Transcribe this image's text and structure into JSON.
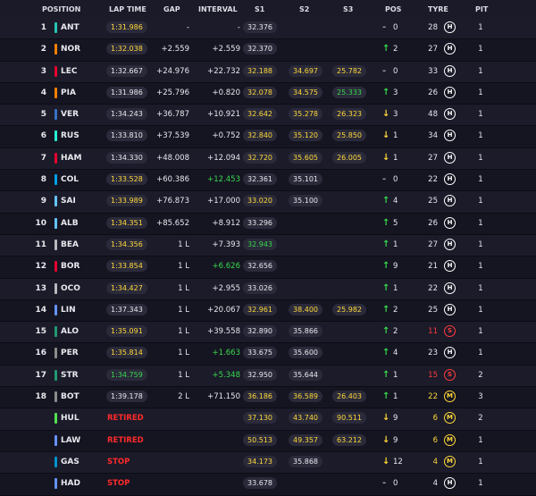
{
  "header": {
    "position": "POSITION",
    "lap_time": "LAP TIME",
    "gap": "GAP",
    "interval": "INTERVAL",
    "s1": "S1",
    "s2": "S2",
    "s3": "S3",
    "pos": "POS",
    "tyre": "TYRE",
    "pit": "PIT"
  },
  "rows": [
    {
      "pos": "1",
      "code": "ANT",
      "team": "#26c6b3",
      "lap": "1:31.986",
      "lap_c": "yellow",
      "gap": "-",
      "interval": "-",
      "s1": "32.376",
      "s1_c": "white",
      "s2": "",
      "s2_c": "white",
      "s3": "",
      "s3_c": "white",
      "arrow": "-",
      "arrow_c": "gray",
      "posch": "0",
      "laps": "28",
      "tyre": "H",
      "tyre_c": "#ffffff",
      "laps_c": "white",
      "pit": "1"
    },
    {
      "pos": "2",
      "code": "NOR",
      "team": "#ff8000",
      "lap": "1:32.038",
      "lap_c": "yellow",
      "gap": "+2.559",
      "interval": "+2.559",
      "s1": "32.370",
      "s1_c": "white",
      "s2": "",
      "s2_c": "white",
      "s3": "",
      "s3_c": "white",
      "arrow": "↑",
      "arrow_c": "green",
      "posch": "2",
      "laps": "27",
      "tyre": "H",
      "tyre_c": "#ffffff",
      "laps_c": "white",
      "pit": "1"
    },
    {
      "pos": "3",
      "code": "LEC",
      "team": "#e8002d",
      "lap": "1:32.667",
      "lap_c": "white",
      "gap": "+24.976",
      "interval": "+22.732",
      "s1": "32.188",
      "s1_c": "yellow",
      "s2": "34.697",
      "s2_c": "yellow",
      "s3": "25.782",
      "s3_c": "yellow",
      "arrow": "-",
      "arrow_c": "gray",
      "posch": "0",
      "laps": "33",
      "tyre": "H",
      "tyre_c": "#ffffff",
      "laps_c": "white",
      "pit": "1"
    },
    {
      "pos": "4",
      "code": "PIA",
      "team": "#ff8000",
      "lap": "1:31.986",
      "lap_c": "white",
      "gap": "+25.796",
      "interval": "+0.820",
      "s1": "32.078",
      "s1_c": "yellow",
      "s2": "34.575",
      "s2_c": "yellow",
      "s3": "25.333",
      "s3_c": "green",
      "arrow": "↑",
      "arrow_c": "green",
      "posch": "3",
      "laps": "26",
      "tyre": "H",
      "tyre_c": "#ffffff",
      "laps_c": "white",
      "pit": "1"
    },
    {
      "pos": "5",
      "code": "VER",
      "team": "#3671c6",
      "lap": "1:34.243",
      "lap_c": "white",
      "gap": "+36.787",
      "interval": "+10.921",
      "s1": "32.642",
      "s1_c": "yellow",
      "s2": "35.278",
      "s2_c": "yellow",
      "s3": "26.323",
      "s3_c": "yellow",
      "arrow": "↓",
      "arrow_c": "yellow",
      "posch": "3",
      "laps": "48",
      "tyre": "H",
      "tyre_c": "#ffffff",
      "laps_c": "white",
      "pit": "1"
    },
    {
      "pos": "6",
      "code": "RUS",
      "team": "#27f4d2",
      "lap": "1:33.810",
      "lap_c": "white",
      "gap": "+37.539",
      "interval": "+0.752",
      "s1": "32.840",
      "s1_c": "yellow",
      "s2": "35.120",
      "s2_c": "yellow",
      "s3": "25.850",
      "s3_c": "yellow",
      "arrow": "↓",
      "arrow_c": "yellow",
      "posch": "1",
      "laps": "34",
      "tyre": "H",
      "tyre_c": "#ffffff",
      "laps_c": "white",
      "pit": "1"
    },
    {
      "pos": "7",
      "code": "HAM",
      "team": "#e8002d",
      "lap": "1:34.330",
      "lap_c": "white",
      "gap": "+48.008",
      "interval": "+12.094",
      "s1": "32.720",
      "s1_c": "yellow",
      "s2": "35.605",
      "s2_c": "yellow",
      "s3": "26.005",
      "s3_c": "yellow",
      "arrow": "↓",
      "arrow_c": "yellow",
      "posch": "1",
      "laps": "27",
      "tyre": "H",
      "tyre_c": "#ffffff",
      "laps_c": "white",
      "pit": "1"
    },
    {
      "pos": "8",
      "code": "COL",
      "team": "#00a1e8",
      "lap": "1:33.528",
      "lap_c": "yellow",
      "gap": "+60.386",
      "interval": "+12.453",
      "int_c": "green",
      "s1": "32.361",
      "s1_c": "white",
      "s2": "35.101",
      "s2_c": "white",
      "s3": "",
      "s3_c": "white",
      "arrow": "-",
      "arrow_c": "gray",
      "posch": "0",
      "laps": "22",
      "tyre": "H",
      "tyre_c": "#ffffff",
      "laps_c": "white",
      "pit": "1"
    },
    {
      "pos": "9",
      "code": "SAI",
      "team": "#64c4ff",
      "lap": "1:33.989",
      "lap_c": "yellow",
      "gap": "+76.873",
      "interval": "+17.000",
      "s1": "33.020",
      "s1_c": "yellow",
      "s2": "35.100",
      "s2_c": "white",
      "s3": "",
      "s3_c": "white",
      "arrow": "↑",
      "arrow_c": "green",
      "posch": "4",
      "laps": "25",
      "tyre": "H",
      "tyre_c": "#ffffff",
      "laps_c": "white",
      "pit": "1"
    },
    {
      "pos": "10",
      "code": "ALB",
      "team": "#64c4ff",
      "lap": "1:34.351",
      "lap_c": "yellow",
      "gap": "+85.652",
      "interval": "+8.912",
      "s1": "33.296",
      "s1_c": "white",
      "s2": "",
      "s2_c": "white",
      "s3": "",
      "s3_c": "white",
      "arrow": "↑",
      "arrow_c": "green",
      "posch": "5",
      "laps": "26",
      "tyre": "H",
      "tyre_c": "#ffffff",
      "laps_c": "white",
      "pit": "1"
    },
    {
      "pos": "11",
      "code": "BEA",
      "team": "#b6babd",
      "lap": "1:34.356",
      "lap_c": "yellow",
      "gap": "1 L",
      "interval": "+7.393",
      "s1": "32.943",
      "s1_c": "green",
      "s2": "",
      "s2_c": "white",
      "s3": "",
      "s3_c": "white",
      "arrow": "↑",
      "arrow_c": "green",
      "posch": "1",
      "laps": "27",
      "tyre": "H",
      "tyre_c": "#ffffff",
      "laps_c": "white",
      "pit": "1"
    },
    {
      "pos": "12",
      "code": "BOR",
      "team": "#e8002d",
      "lap": "1:33.854",
      "lap_c": "yellow",
      "gap": "1 L",
      "interval": "+6.626",
      "int_c": "green",
      "s1": "32.656",
      "s1_c": "white",
      "s2": "",
      "s2_c": "white",
      "s3": "",
      "s3_c": "white",
      "arrow": "↑",
      "arrow_c": "green",
      "posch": "9",
      "laps": "21",
      "tyre": "H",
      "tyre_c": "#ffffff",
      "laps_c": "white",
      "pit": "1"
    },
    {
      "pos": "13",
      "code": "OCO",
      "team": "#b6babd",
      "lap": "1:34.427",
      "lap_c": "yellow",
      "gap": "1 L",
      "interval": "+2.955",
      "s1": "33.026",
      "s1_c": "white",
      "s2": "",
      "s2_c": "white",
      "s3": "",
      "s3_c": "white",
      "arrow": "↑",
      "arrow_c": "green",
      "posch": "1",
      "laps": "22",
      "tyre": "H",
      "tyre_c": "#ffffff",
      "laps_c": "white",
      "pit": "1"
    },
    {
      "pos": "14",
      "code": "LIN",
      "team": "#6692ff",
      "lap": "1:37.343",
      "lap_c": "white",
      "gap": "1 L",
      "interval": "+20.067",
      "s1": "32.961",
      "s1_c": "yellow",
      "s2": "38.400",
      "s2_c": "yellow",
      "s3": "25.982",
      "s3_c": "yellow",
      "arrow": "↑",
      "arrow_c": "green",
      "posch": "2",
      "laps": "25",
      "tyre": "H",
      "tyre_c": "#ffffff",
      "laps_c": "white",
      "pit": "1"
    },
    {
      "pos": "15",
      "code": "ALO",
      "team": "#229971",
      "lap": "1:35.091",
      "lap_c": "yellow",
      "gap": "1 L",
      "interval": "+39.558",
      "s1": "32.890",
      "s1_c": "white",
      "s2": "35.866",
      "s2_c": "white",
      "s3": "",
      "s3_c": "white",
      "arrow": "↑",
      "arrow_c": "green",
      "posch": "2",
      "laps": "11",
      "tyre": "S",
      "tyre_c": "#ff3b3b",
      "laps_c": "red",
      "pit": "1"
    },
    {
      "pos": "16",
      "code": "PER",
      "team": "#8b8b8b",
      "lap": "1:35.814",
      "lap_c": "yellow",
      "gap": "1 L",
      "interval": "+1.663",
      "int_c": "green",
      "s1": "33.675",
      "s1_c": "white",
      "s2": "35.600",
      "s2_c": "white",
      "s3": "",
      "s3_c": "white",
      "arrow": "↑",
      "arrow_c": "green",
      "posch": "4",
      "laps": "23",
      "tyre": "H",
      "tyre_c": "#ffffff",
      "laps_c": "white",
      "pit": "1"
    },
    {
      "pos": "17",
      "code": "STR",
      "team": "#229971",
      "lap": "1:34.759",
      "lap_c": "green",
      "gap": "1 L",
      "interval": "+5.348",
      "int_c": "green",
      "s1": "32.950",
      "s1_c": "white",
      "s2": "35.644",
      "s2_c": "white",
      "s3": "",
      "s3_c": "white",
      "arrow": "↑",
      "arrow_c": "green",
      "posch": "1",
      "laps": "15",
      "tyre": "S",
      "tyre_c": "#ff3b3b",
      "laps_c": "red",
      "pit": "2"
    },
    {
      "pos": "18",
      "code": "BOT",
      "team": "#8b8b8b",
      "lap": "1:39.178",
      "lap_c": "white",
      "gap": "2 L",
      "interval": "+71.150",
      "s1": "36.186",
      "s1_c": "yellow",
      "s2": "36.589",
      "s2_c": "yellow",
      "s3": "26.403",
      "s3_c": "yellow",
      "arrow": "↑",
      "arrow_c": "green",
      "posch": "1",
      "laps": "22",
      "tyre": "M",
      "tyre_c": "#ffd83a",
      "laps_c": "yellow",
      "pit": "3"
    },
    {
      "pos": "",
      "code": "HUL",
      "team": "#52e252",
      "status": "RETIRED",
      "lap": "",
      "lap_c": "white",
      "gap": "",
      "interval": "",
      "s1": "37.130",
      "s1_c": "yellow",
      "s2": "43.740",
      "s2_c": "yellow",
      "s3": "90.511",
      "s3_c": "yellow",
      "arrow": "↓",
      "arrow_c": "yellow",
      "posch": "9",
      "laps": "6",
      "tyre": "M",
      "tyre_c": "#ffd83a",
      "laps_c": "yellow",
      "pit": "2"
    },
    {
      "pos": "",
      "code": "LAW",
      "team": "#6692ff",
      "status": "RETIRED",
      "lap": "",
      "lap_c": "white",
      "gap": "",
      "interval": "",
      "s1": "50.513",
      "s1_c": "yellow",
      "s2": "49.357",
      "s2_c": "yellow",
      "s3": "63.212",
      "s3_c": "yellow",
      "arrow": "↓",
      "arrow_c": "yellow",
      "posch": "9",
      "laps": "6",
      "tyre": "M",
      "tyre_c": "#ffd83a",
      "laps_c": "yellow",
      "pit": "1"
    },
    {
      "pos": "",
      "code": "GAS",
      "team": "#0093cc",
      "status": "STOP",
      "lap": "",
      "lap_c": "white",
      "gap": "",
      "interval": "",
      "s1": "34.173",
      "s1_c": "yellow",
      "s2": "35.868",
      "s2_c": "white",
      "s3": "",
      "s3_c": "white",
      "arrow": "↓",
      "arrow_c": "yellow",
      "posch": "12",
      "laps": "4",
      "tyre": "M",
      "tyre_c": "#ffd83a",
      "laps_c": "yellow",
      "pit": "1"
    },
    {
      "pos": "",
      "code": "HAD",
      "team": "#6692ff",
      "status": "STOP",
      "lap": "",
      "lap_c": "white",
      "gap": "",
      "interval": "",
      "s1": "33.678",
      "s1_c": "white",
      "s2": "",
      "s2_c": "white",
      "s3": "",
      "s3_c": "white",
      "arrow": "-",
      "arrow_c": "gray",
      "posch": "0",
      "laps": "4",
      "tyre": "H",
      "tyre_c": "#ffffff",
      "laps_c": "white",
      "pit": "1"
    }
  ],
  "colors": {
    "background": "#13131f",
    "header_bg": "#1a1a28",
    "sector_yellow": "#ffd83a",
    "sector_green": "#38d94c",
    "status_red": "#ff2a2a"
  }
}
